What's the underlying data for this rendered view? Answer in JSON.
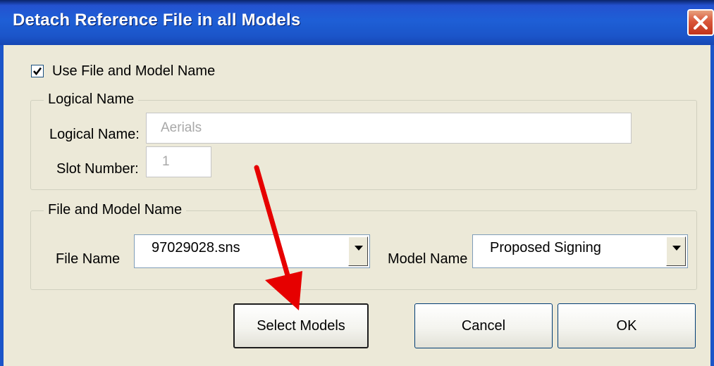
{
  "window": {
    "title": "Detach Reference File in all Models",
    "close_icon": "close-icon"
  },
  "use_file_model": {
    "label": "Use File and Model Name",
    "checked": true
  },
  "logical_group": {
    "legend": "Logical Name",
    "logical_name_label": "Logical Name:",
    "logical_name_value": "Aerials",
    "slot_number_label": "Slot Number:",
    "slot_number_value": "1"
  },
  "file_group": {
    "legend": "File and Model Name",
    "file_name_label": "File Name",
    "file_name_value": "97029028.sns",
    "model_name_label": "Model Name",
    "model_name_value": "Proposed Signing"
  },
  "buttons": {
    "select_models": "Select Models",
    "cancel": "Cancel",
    "ok": "OK"
  },
  "colors": {
    "titlebar": "#1b55c9",
    "dialog_bg": "#ece9d8",
    "annotation_arrow": "#e60000"
  }
}
